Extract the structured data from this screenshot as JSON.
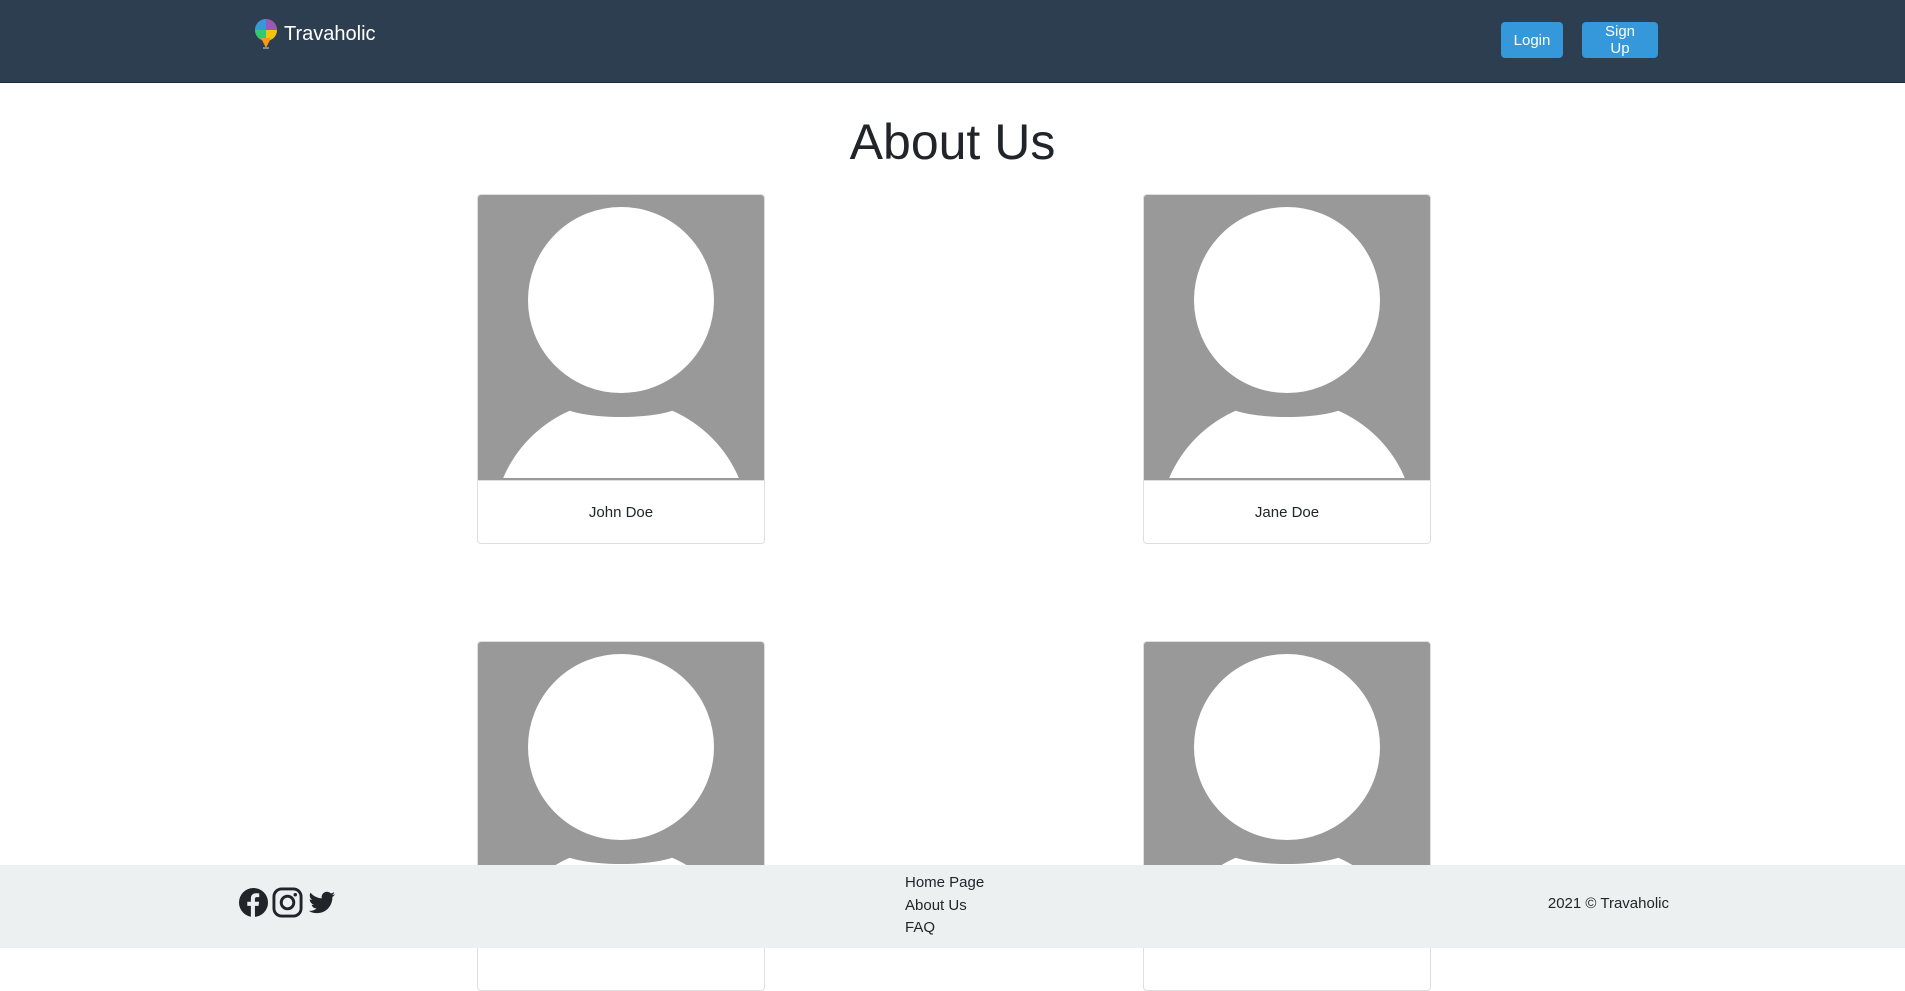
{
  "navbar": {
    "brand_name": "Travaholic",
    "login_label": "Login",
    "signup_label": "Sign Up",
    "background_color": "#2c3e50",
    "button_color": "#3498db"
  },
  "main": {
    "title": "About Us",
    "team": [
      {
        "name": "John Doe",
        "photo_icon": "user-avatar-placeholder"
      },
      {
        "name": "Jane Doe",
        "photo_icon": "user-avatar-placeholder"
      },
      {
        "name": "",
        "photo_icon": "user-avatar-placeholder"
      },
      {
        "name": "",
        "photo_icon": "user-avatar-placeholder"
      }
    ]
  },
  "footer": {
    "social": [
      "facebook-icon",
      "instagram-icon",
      "twitter-icon"
    ],
    "links": [
      "Home Page",
      "About Us",
      "FAQ"
    ],
    "copyright": "2021 © Travaholic",
    "background_color": "#ecf0f1"
  }
}
